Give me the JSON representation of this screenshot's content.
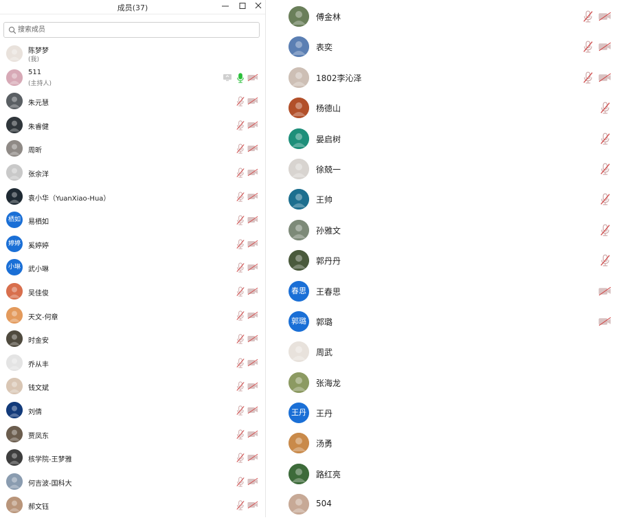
{
  "window": {
    "title": "成员(37)"
  },
  "search": {
    "placeholder": "搜索成员"
  },
  "colors": {
    "accent_blue": "#1a6fd6",
    "mic_active": "#2bbf3a",
    "muted_icon": "#c8a5a5"
  },
  "left_members": [
    {
      "name": "陈梦梦",
      "role": "(我)",
      "avatar_text": "",
      "avatar_color": "#e9e2dc",
      "mic": "none",
      "video": false
    },
    {
      "name": "511",
      "role": "(主持人)",
      "avatar_text": "",
      "avatar_color": "#d7a9b6",
      "mic": "active",
      "video": "off",
      "sharing": true
    },
    {
      "name": "朱元慧",
      "role": "",
      "avatar_text": "",
      "avatar_color": "#5a5f63",
      "mic": "muted",
      "video": "off"
    },
    {
      "name": "朱睿健",
      "role": "",
      "avatar_text": "",
      "avatar_color": "#30363b",
      "mic": "muted",
      "video": "off"
    },
    {
      "name": "周昕",
      "role": "",
      "avatar_text": "",
      "avatar_color": "#8f8a86",
      "mic": "muted",
      "video": "off"
    },
    {
      "name": "张余洋",
      "role": "",
      "avatar_text": "",
      "avatar_color": "#c9c9c9",
      "mic": "muted",
      "video": "off"
    },
    {
      "name": "袁小华（YuanXiao-Hua）",
      "role": "",
      "avatar_text": "",
      "avatar_color": "#1f2a33",
      "mic": "muted",
      "video": "off"
    },
    {
      "name": "易栖如",
      "role": "",
      "avatar_text": "栖如",
      "avatar_color": "#1a6fd6",
      "mic": "muted",
      "video": "off"
    },
    {
      "name": "奚婷婷",
      "role": "",
      "avatar_text": "婷婷",
      "avatar_color": "#1a6fd6",
      "mic": "muted",
      "video": "off"
    },
    {
      "name": "武小琳",
      "role": "",
      "avatar_text": "小琳",
      "avatar_color": "#1a6fd6",
      "mic": "muted",
      "video": "off"
    },
    {
      "name": "吴佳俊",
      "role": "",
      "avatar_text": "",
      "avatar_color": "#d86f4d",
      "mic": "muted",
      "video": "off"
    },
    {
      "name": "天文-何章",
      "role": "",
      "avatar_text": "",
      "avatar_color": "#e39a5c",
      "mic": "muted",
      "video": "off"
    },
    {
      "name": "时金安",
      "role": "",
      "avatar_text": "",
      "avatar_color": "#4f4a3e",
      "mic": "muted",
      "video": "off"
    },
    {
      "name": "乔从丰",
      "role": "",
      "avatar_text": "",
      "avatar_color": "#e4e4e4",
      "mic": "muted",
      "video": "off"
    },
    {
      "name": "钱文斌",
      "role": "",
      "avatar_text": "",
      "avatar_color": "#d9c6b4",
      "mic": "muted",
      "video": "off"
    },
    {
      "name": "刘倩",
      "role": "",
      "avatar_text": "",
      "avatar_color": "#123a7a",
      "mic": "muted",
      "video": "off"
    },
    {
      "name": "贾凤东",
      "role": "",
      "avatar_text": "",
      "avatar_color": "#6b5d4e",
      "mic": "muted",
      "video": "off"
    },
    {
      "name": "核学院-王梦雅",
      "role": "",
      "avatar_text": "",
      "avatar_color": "#3e3e3e",
      "mic": "muted",
      "video": "off"
    },
    {
      "name": "何吉波-国科大",
      "role": "",
      "avatar_text": "",
      "avatar_color": "#8a9cb0",
      "mic": "muted",
      "video": "off"
    },
    {
      "name": "郝文钰",
      "role": "",
      "avatar_text": "",
      "avatar_color": "#b9957a",
      "mic": "muted",
      "video": "off"
    }
  ],
  "right_members": [
    {
      "name": "傅金林",
      "avatar_text": "",
      "avatar_color": "#6a7f5a",
      "mic": "muted",
      "video": "off"
    },
    {
      "name": "表奕",
      "avatar_text": "",
      "avatar_color": "#5b7fb3",
      "mic": "muted",
      "video": "off"
    },
    {
      "name": "1802李沁泽",
      "avatar_text": "",
      "avatar_color": "#cdbfb5",
      "mic": "muted",
      "video": "off"
    },
    {
      "name": "杨德山",
      "avatar_text": "",
      "avatar_color": "#b2502a",
      "mic": "muted",
      "video": "none"
    },
    {
      "name": "晏启树",
      "avatar_text": "",
      "avatar_color": "#1e8f7a",
      "mic": "muted",
      "video": "none"
    },
    {
      "name": "徐兢一",
      "avatar_text": "",
      "avatar_color": "#d8d4d0",
      "mic": "muted",
      "video": "none"
    },
    {
      "name": "王帅",
      "avatar_text": "",
      "avatar_color": "#1d6f8f",
      "mic": "muted",
      "video": "none"
    },
    {
      "name": "孙雅文",
      "avatar_text": "",
      "avatar_color": "#7d8a78",
      "mic": "muted",
      "video": "none"
    },
    {
      "name": "郭丹丹",
      "avatar_text": "",
      "avatar_color": "#4a5a3c",
      "mic": "muted",
      "video": "none"
    },
    {
      "name": "王春思",
      "avatar_text": "春思",
      "avatar_color": "#1a6fd6",
      "mic": "none",
      "video": "off"
    },
    {
      "name": "郭璐",
      "avatar_text": "郭璐",
      "avatar_color": "#1a6fd6",
      "mic": "none",
      "video": "off"
    },
    {
      "name": "周武",
      "avatar_text": "",
      "avatar_color": "#e8e2dc",
      "mic": "none",
      "video": "none"
    },
    {
      "name": "张海龙",
      "avatar_text": "",
      "avatar_color": "#8c9a62",
      "mic": "none",
      "video": "none"
    },
    {
      "name": "王丹",
      "avatar_text": "王丹",
      "avatar_color": "#1a6fd6",
      "mic": "none",
      "video": "none"
    },
    {
      "name": "汤勇",
      "avatar_text": "",
      "avatar_color": "#c98a4a",
      "mic": "none",
      "video": "none"
    },
    {
      "name": "路红亮",
      "avatar_text": "",
      "avatar_color": "#3d6b3a",
      "mic": "none",
      "video": "none"
    },
    {
      "name": "504",
      "avatar_text": "",
      "avatar_color": "#c7a996",
      "mic": "none",
      "video": "none"
    }
  ]
}
